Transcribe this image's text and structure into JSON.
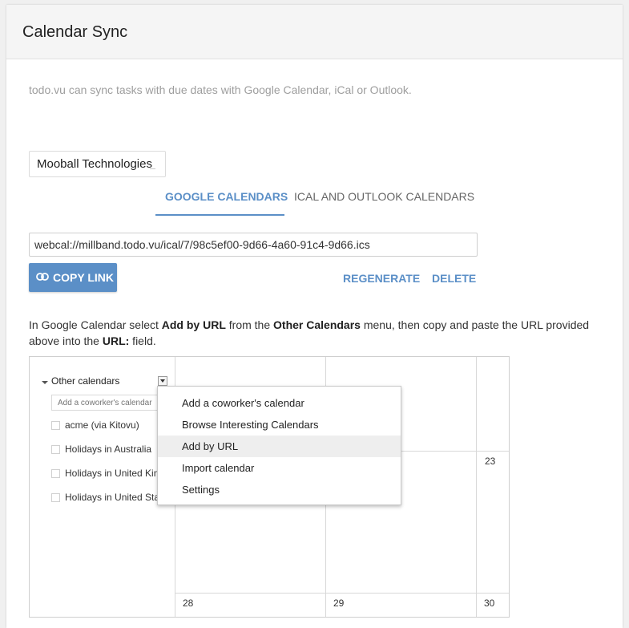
{
  "header": {
    "title": "Calendar Sync"
  },
  "intro_text": "todo.vu can sync tasks with due dates with Google Calendar, iCal or Outlook.",
  "org_select": {
    "value": "Mooball Technologies"
  },
  "tabs": [
    {
      "label": "GOOGLE CALENDARS",
      "active": true
    },
    {
      "label": "ICAL AND OUTLOOK CALENDARS",
      "active": false
    }
  ],
  "sync_url": "webcal://millband.todo.vu/ical/7/98c5ef00-9d66-4a60-91c4-9d66.ics",
  "actions": {
    "copy_link": "COPY LINK",
    "regenerate": "REGENERATE",
    "delete": "DELETE"
  },
  "instructions": {
    "part1": "In Google Calendar select ",
    "add_by_url": "Add by URL",
    "part2": " from the ",
    "other_calendars": "Other Calendars",
    "part3": " menu, then copy and paste the URL provided above into the ",
    "url_field": "URL:",
    "part4": " field."
  },
  "gcal": {
    "other_calendars_label": "Other calendars",
    "coworker_placeholder": "Add a coworker's calendar",
    "calendars": [
      "acme (via Kitovu)",
      "Holidays in Australia",
      "Holidays in United Kingdom",
      "Holidays in United States"
    ],
    "day_numbers": {
      "d23": "23",
      "d28": "28",
      "d29": "29",
      "d30": "30"
    },
    "menu_items": [
      {
        "label": "Add a coworker's calendar",
        "highlighted": false
      },
      {
        "label": "Browse Interesting Calendars",
        "highlighted": false
      },
      {
        "label": "Add by URL",
        "highlighted": true
      },
      {
        "label": "Import calendar",
        "highlighted": false
      },
      {
        "label": "Settings",
        "highlighted": false
      }
    ]
  },
  "colors": {
    "accent": "#5b8fc7",
    "header_bg": "#f5f5f5",
    "muted_text": "#9e9e9e"
  },
  "icons": {
    "copy": "link-icon"
  }
}
